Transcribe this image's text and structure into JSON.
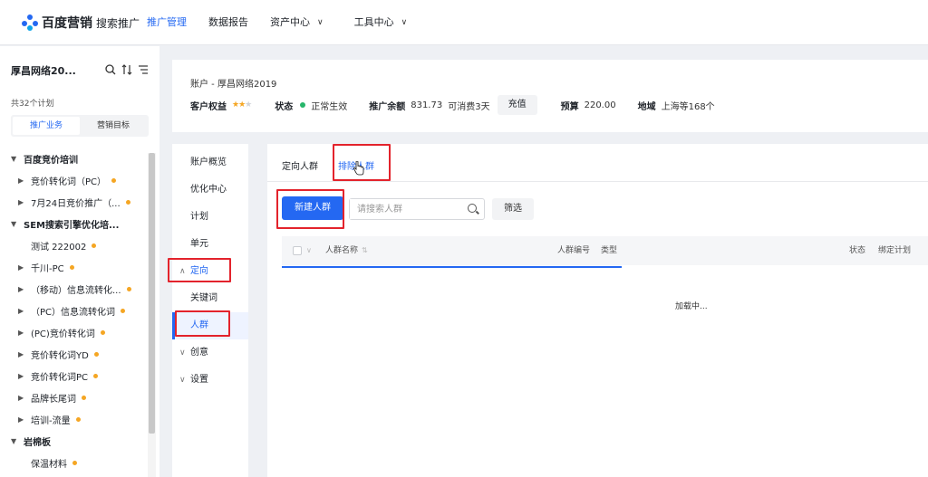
{
  "header": {
    "brand": "百度营销",
    "brand_sub": "搜索推广",
    "nav": [
      {
        "label": "推广管理",
        "active": true,
        "dropdown": false
      },
      {
        "label": "数据报告",
        "active": false,
        "dropdown": false
      },
      {
        "label": "资产中心",
        "active": false,
        "dropdown": true
      },
      {
        "label": "工具中心",
        "active": false,
        "dropdown": true
      }
    ]
  },
  "sidebar": {
    "account_title": "厚昌网络20...",
    "plan_count": "共32个计划",
    "tabs": [
      "推广业务",
      "营销目标"
    ],
    "tree": [
      {
        "label": "百度竞价培训",
        "level": "lvl0",
        "expanded": true,
        "dot": false
      },
      {
        "label": "竞价转化词（PC）",
        "level": "lvl1",
        "expanded": false,
        "dot": true
      },
      {
        "label": "7月24日竞价推广（...",
        "level": "lvl1",
        "expanded": false,
        "dot": true
      },
      {
        "label": "SEM搜索引擎优化培...",
        "level": "lvl0",
        "expanded": true,
        "dot": false
      },
      {
        "label": "测试 222002",
        "level": "leaf",
        "expanded": false,
        "dot": true
      },
      {
        "label": "千川-PC",
        "level": "lvl1",
        "expanded": false,
        "dot": true
      },
      {
        "label": "（移动）信息流转化...",
        "level": "lvl1",
        "expanded": false,
        "dot": true
      },
      {
        "label": "（PC）信息流转化词",
        "level": "lvl1",
        "expanded": false,
        "dot": true
      },
      {
        "label": "(PC)竞价转化词",
        "level": "lvl1",
        "expanded": false,
        "dot": true
      },
      {
        "label": "竞价转化词YD",
        "level": "lvl1",
        "expanded": false,
        "dot": true
      },
      {
        "label": "竞价转化词PC",
        "level": "lvl1",
        "expanded": false,
        "dot": true
      },
      {
        "label": "品牌长尾词",
        "level": "lvl1",
        "expanded": false,
        "dot": true
      },
      {
        "label": "培训-流量",
        "level": "lvl1",
        "expanded": false,
        "dot": true
      },
      {
        "label": "岩棉板",
        "level": "lvl0",
        "expanded": true,
        "dot": false
      },
      {
        "label": "保温材料",
        "level": "leaf",
        "expanded": false,
        "dot": true
      }
    ]
  },
  "account": {
    "title": "账户 - 厚昌网络2019",
    "rights_label": "客户权益",
    "stars_on": "★★",
    "stars_off": "★",
    "status_label": "状态",
    "status_value": "正常生效",
    "balance_label": "推广余额",
    "balance_value": "831.73",
    "balance_days": "可消费3天",
    "recharge": "充值",
    "budget_label": "预算",
    "budget_value": "220.00",
    "region_label": "地域",
    "region_value": "上海等168个"
  },
  "subnav": [
    {
      "label": "账户概览",
      "type": "item"
    },
    {
      "label": "优化中心",
      "type": "item"
    },
    {
      "label": "计划",
      "type": "item"
    },
    {
      "label": "单元",
      "type": "item"
    },
    {
      "label": "定向",
      "type": "group-open"
    },
    {
      "label": "关键词",
      "type": "item"
    },
    {
      "label": "人群",
      "type": "selected"
    },
    {
      "label": "创意",
      "type": "group"
    },
    {
      "label": "设置",
      "type": "group"
    }
  ],
  "content": {
    "tabs": [
      {
        "label": "定向人群",
        "active": false
      },
      {
        "label": "排除人群",
        "active": true
      }
    ],
    "new_button": "新建人群",
    "search_placeholder": "请搜索人群",
    "filter_button": "筛选",
    "columns": {
      "name": "人群名称",
      "id": "人群编号",
      "type": "类型",
      "status": "状态",
      "bind": "绑定计划"
    },
    "loading": "加载中..."
  },
  "colors": {
    "accent": "#2468f2",
    "annotation": "#e3232c",
    "status_ok": "#27b66b",
    "dot": "#f5a623"
  }
}
